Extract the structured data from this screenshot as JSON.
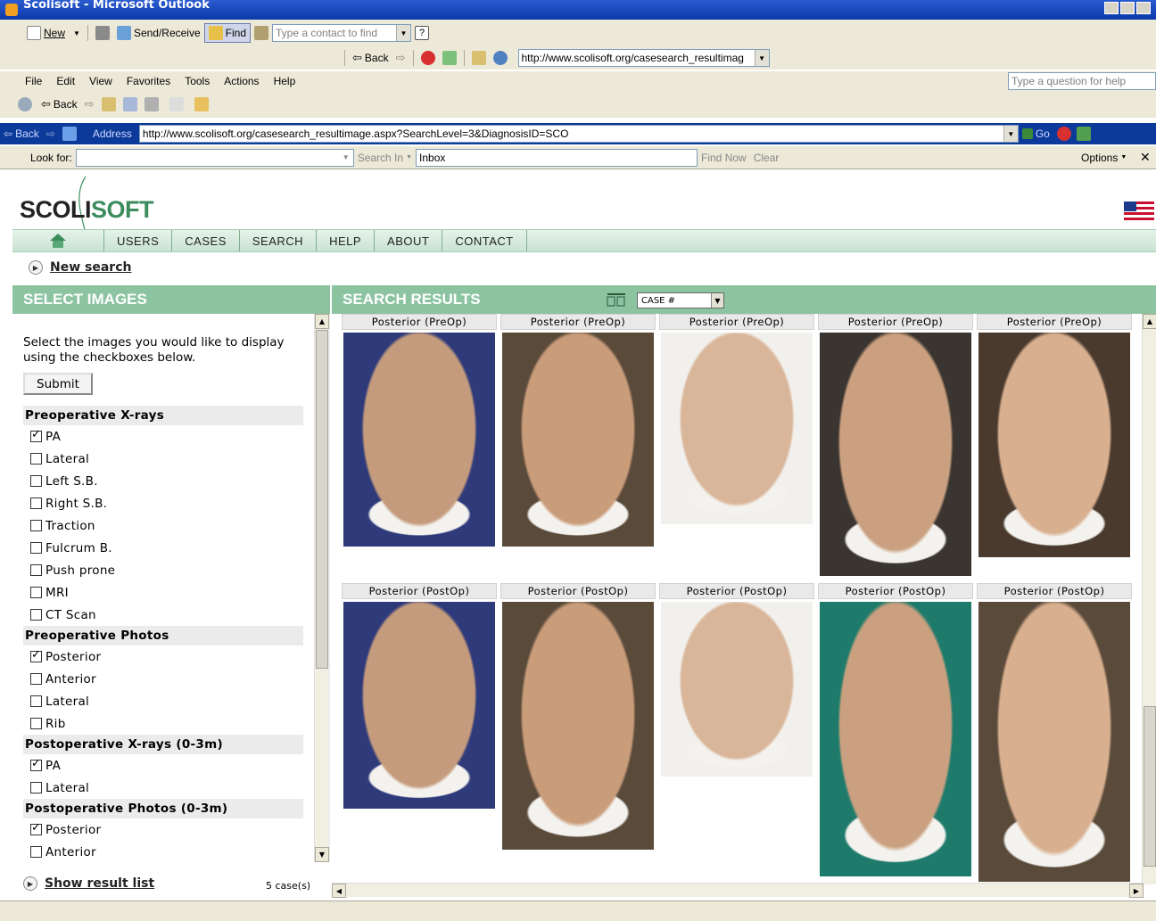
{
  "window": {
    "title": "Scolisoft - Microsoft Outlook"
  },
  "toolbar1": {
    "new_label": "New",
    "send_receive_label": "Send/Receive",
    "find_label": "Find",
    "contact_placeholder": "Type a contact to find"
  },
  "webbar": {
    "back_label": "Back",
    "url": "http://www.scolisoft.org/casesearch_resultimag"
  },
  "menu": {
    "items": [
      "File",
      "Edit",
      "View",
      "Favorites",
      "Tools",
      "Actions",
      "Help"
    ],
    "help_placeholder": "Type a question for help"
  },
  "toolbar3": {
    "back_label": "Back"
  },
  "addressbar": {
    "back_label": "Back",
    "address_label": "Address",
    "url": "http://www.scolisoft.org/casesearch_resultimage.aspx?SearchLevel=3&DiagnosisID=SCO",
    "go_label": "Go"
  },
  "findbar": {
    "look_for_label": "Look for:",
    "search_in_label": "Search In",
    "search_in_value": "Inbox",
    "find_now_label": "Find Now",
    "clear_label": "Clear",
    "options_label": "Options"
  },
  "site": {
    "logo_text_a": "SCOLI",
    "logo_text_b": "SOFT",
    "nav": [
      "USERS",
      "CASES",
      "SEARCH",
      "HELP",
      "ABOUT",
      "CONTACT"
    ],
    "new_search": "New search",
    "select_images_title": "SELECT IMAGES",
    "search_results_title": "SEARCH RESULTS",
    "sort_value": "CASE #",
    "instructions": "Select the images you would like to display using the checkboxes below.",
    "submit": "Submit",
    "groups": [
      {
        "title": "Preoperative X-rays",
        "options": [
          {
            "label": "PA",
            "checked": true
          },
          {
            "label": "Lateral",
            "checked": false
          },
          {
            "label": "Left S.B.",
            "checked": false
          },
          {
            "label": "Right S.B.",
            "checked": false
          },
          {
            "label": "Traction",
            "checked": false
          },
          {
            "label": "Fulcrum B.",
            "checked": false
          },
          {
            "label": "Push prone",
            "checked": false
          },
          {
            "label": "MRI",
            "checked": false
          },
          {
            "label": "CT Scan",
            "checked": false
          }
        ]
      },
      {
        "title": "Preoperative Photos",
        "options": [
          {
            "label": "Posterior",
            "checked": true
          },
          {
            "label": "Anterior",
            "checked": false
          },
          {
            "label": "Lateral",
            "checked": false
          },
          {
            "label": "Rib",
            "checked": false
          }
        ]
      },
      {
        "title": "Postoperative X-rays (0-3m)",
        "options": [
          {
            "label": "PA",
            "checked": true
          },
          {
            "label": "Lateral",
            "checked": false
          }
        ]
      },
      {
        "title": "Postoperative Photos (0-3m)",
        "options": [
          {
            "label": "Posterior",
            "checked": true
          },
          {
            "label": "Anterior",
            "checked": false
          }
        ]
      }
    ],
    "show_result_list": "Show result list",
    "case_count": "5 case(s)",
    "results_row1_label": "Posterior (PreOp)",
    "results_row2_label": "Posterior (PostOp)",
    "colors": {
      "accent": "#8cc3a1",
      "nav_bg": "#d5ebdc",
      "logo_green": "#3d8c5d"
    }
  }
}
